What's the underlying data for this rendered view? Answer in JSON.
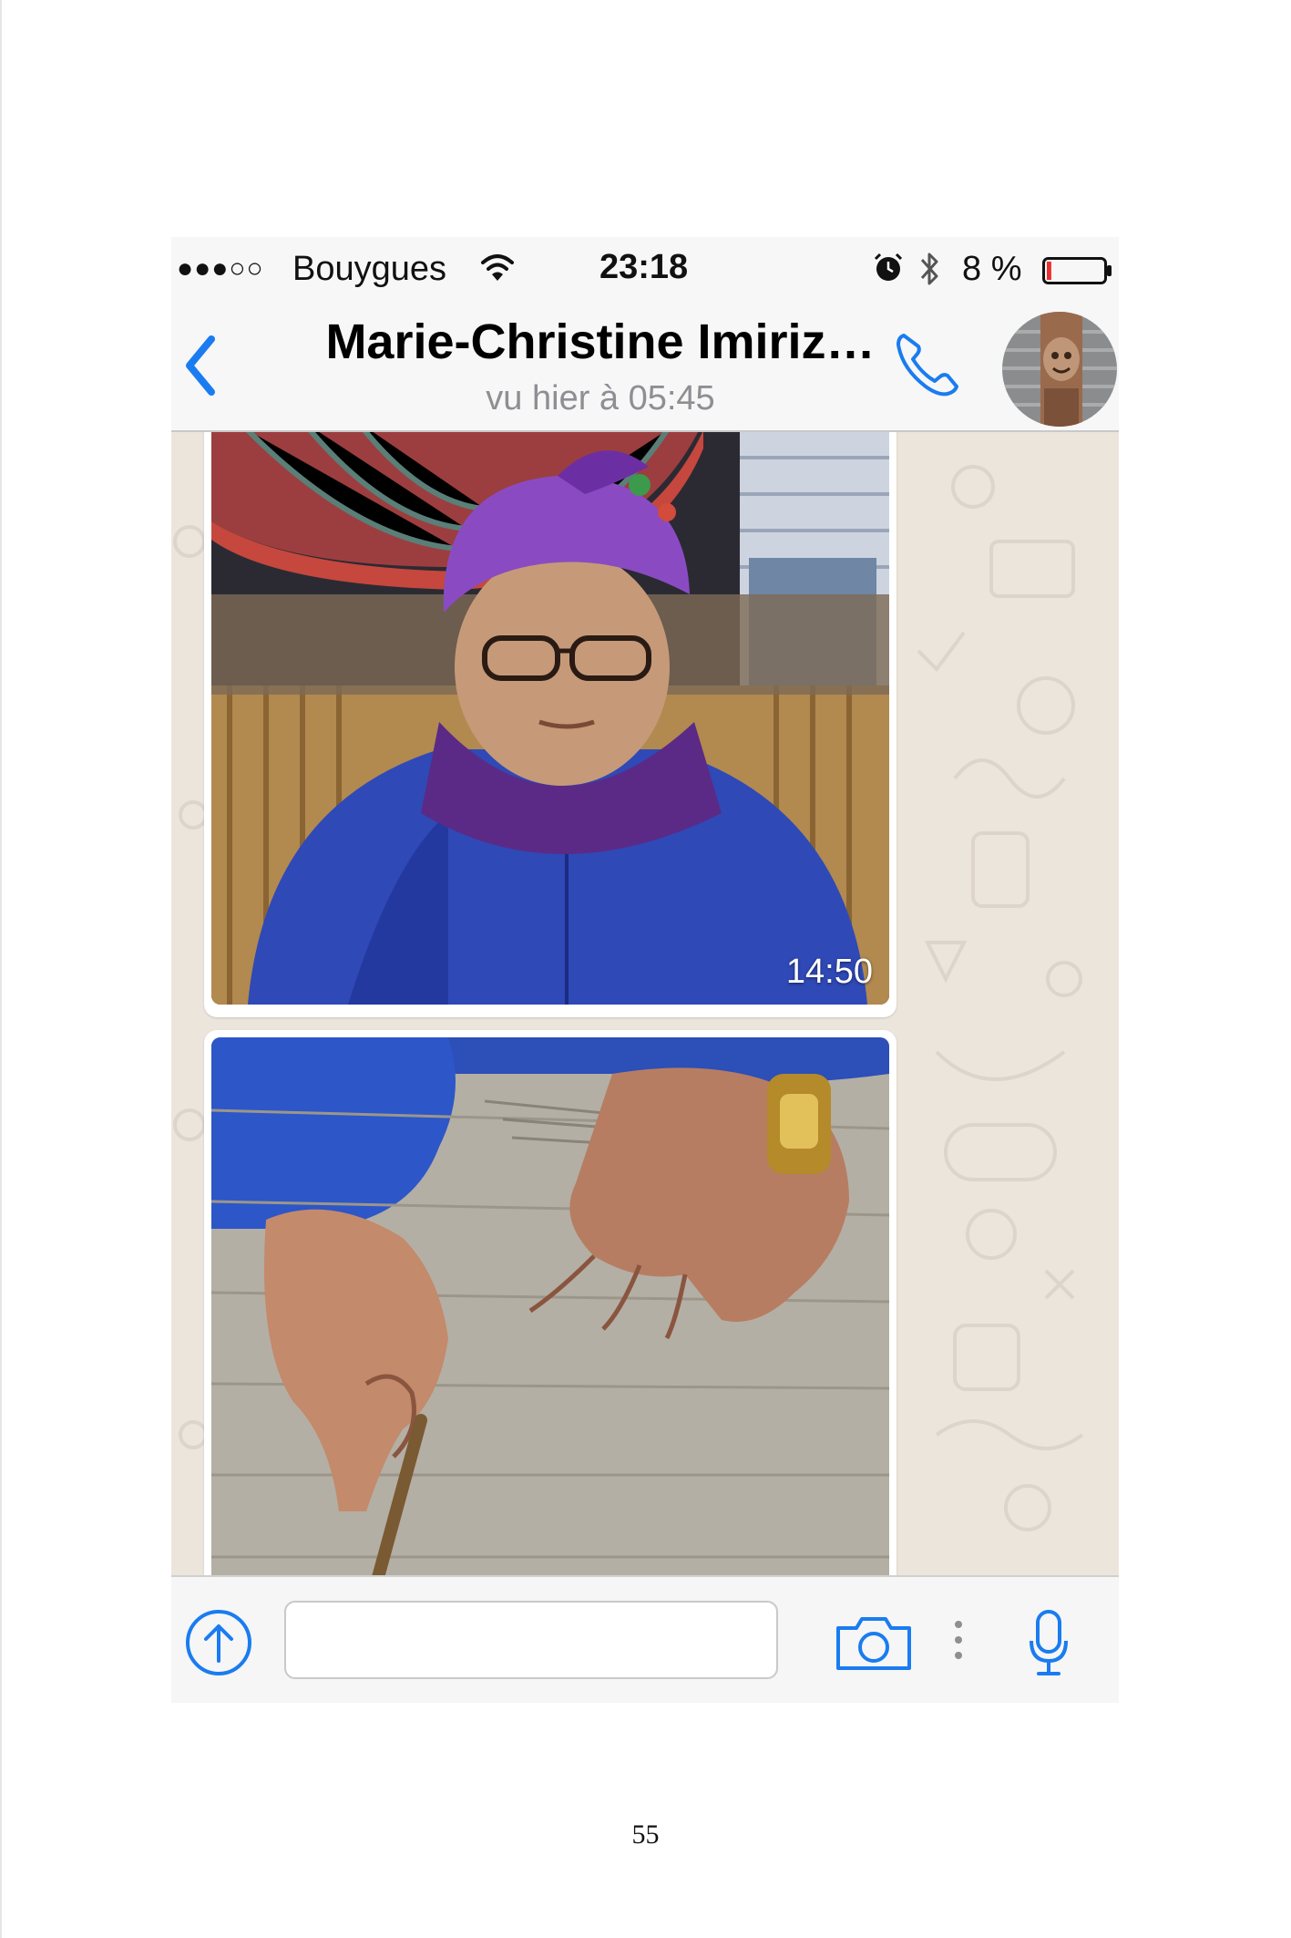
{
  "status_bar": {
    "signal": "●●●○○",
    "carrier": "Bouygues",
    "time": "23:18",
    "battery_percent": "8 %",
    "icons": [
      "wifi-icon",
      "alarm-icon",
      "bluetooth-icon",
      "battery-icon"
    ],
    "battery_level": 0.08
  },
  "header": {
    "contact_name": "Marie-Christine Imiriz…",
    "last_seen": "vu hier à 05:45",
    "icons": [
      "back-chevron-icon",
      "phone-icon",
      "avatar"
    ]
  },
  "messages": [
    {
      "type": "image",
      "description_icon": "photo-woman-weaving",
      "time": "14:50"
    },
    {
      "type": "image",
      "description_icon": "photo-hands-fabric",
      "time": ""
    }
  ],
  "input_bar": {
    "placeholder": "",
    "icons": [
      "share-arrow-icon",
      "camera-icon",
      "more-dots-icon",
      "microphone-icon"
    ]
  },
  "page": {
    "number": "55"
  },
  "colors": {
    "ios_blue": "#1a7cf0",
    "battery_red": "#e8312f",
    "chat_bg": "#ece5dc"
  }
}
